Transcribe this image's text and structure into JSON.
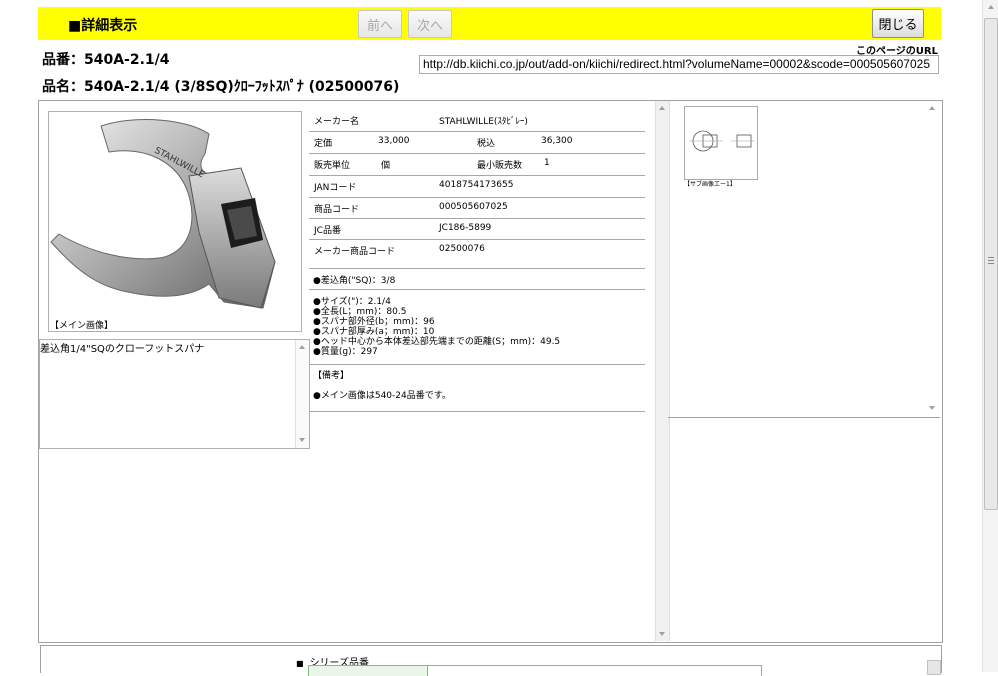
{
  "header": {
    "title": "■詳細表示",
    "prev_label": "前へ",
    "next_label": "次へ",
    "close_label": "閉じる"
  },
  "url": {
    "label": "このページのURL",
    "value": "http://db.kiichi.co.jp/out/add-on/kiichi/redirect.html?volumeName=00002&scode=000505607025"
  },
  "item": {
    "number": "品番：540A-2.1/4",
    "name": "品名：540A-2.1/4 (3/8SQ)ｸﾛｰﾌｯﾄｽﾊﾟﾅ (02500076)"
  },
  "photo": {
    "label": "【メイン画像】"
  },
  "description": "差込角1/4\"SQのクローフットスパナ",
  "specs": {
    "maker_label": "メーカー名",
    "maker_value": "STAHLWILLE(ｽﾀﾋﾞﾚｰ)",
    "list_price_label": "定価",
    "list_price_value": "33,000",
    "tax_label": "税込",
    "tax_value": "36,300",
    "unit_label": "販売単位",
    "unit_value": "個",
    "min_label": "最小販売数",
    "min_value": "1",
    "jan_label": "JANコード",
    "jan_value": "4018754173655",
    "code_label": "商品コード",
    "code_value": "000505607025",
    "jc_label": "JC品番",
    "jc_value": "JC186-5899",
    "maker_code_label": "メーカー商品コード",
    "maker_code_value": "02500076"
  },
  "features": [
    "●差込角(\"SQ)：3/8"
  ],
  "dimensions": [
    "●サイズ(\")：2.1/4",
    "●全長(L；mm)：80.5",
    "●スパナ部外径(b；mm)：96",
    "●スパナ部厚み(a；mm)：10",
    "●ヘッド中心から本体差込部先端までの距離(S；mm)：49.5",
    "●質量(g)：297"
  ],
  "remarks": {
    "label": "【備考】",
    "text": "●メイン画像は540-24品番です。"
  },
  "sub_image": {
    "label": "【サブ画像エー1】"
  },
  "series": {
    "label": "シリーズ品番"
  }
}
